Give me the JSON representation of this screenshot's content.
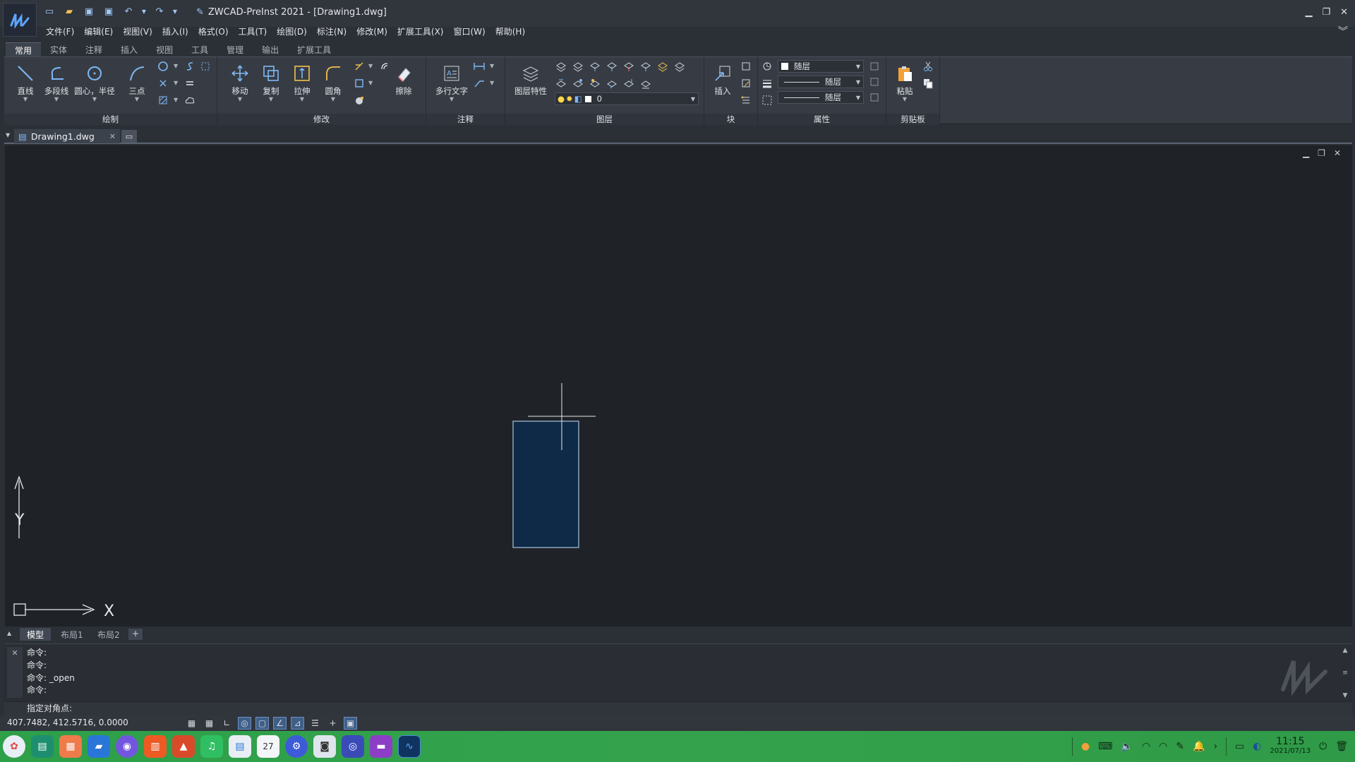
{
  "window": {
    "title": "ZWCAD-PreInst 2021 - [Drawing1.dwg]"
  },
  "menu": [
    "文件(F)",
    "编辑(E)",
    "视图(V)",
    "插入(I)",
    "格式(O)",
    "工具(T)",
    "绘图(D)",
    "标注(N)",
    "修改(M)",
    "扩展工具(X)",
    "窗口(W)",
    "帮助(H)"
  ],
  "ribbon_tabs": [
    "常用",
    "实体",
    "注释",
    "插入",
    "视图",
    "工具",
    "管理",
    "输出",
    "扩展工具"
  ],
  "ribbon": {
    "draw": {
      "title": "绘制",
      "line": "直线",
      "polyline": "多段线",
      "circle": "圆心，半径",
      "arc": "三点"
    },
    "modify": {
      "title": "修改",
      "move": "移动",
      "copy": "复制",
      "stretch": "拉伸",
      "fillet": "圆角",
      "erase": "擦除"
    },
    "annotate": {
      "title": "注释",
      "mtext": "多行文字"
    },
    "layers": {
      "title": "图层",
      "layer_props": "图层特性",
      "current_layer": "0"
    },
    "block": {
      "title": "块",
      "insert": "插入"
    },
    "properties": {
      "title": "属性",
      "color": "随层",
      "linetype": "随层",
      "lineweight": "随层"
    },
    "clipboard": {
      "title": "剪贴板",
      "paste": "粘贴"
    }
  },
  "document_tab": {
    "name": "Drawing1.dwg"
  },
  "ucs": {
    "x_label": "X",
    "y_label": "Y"
  },
  "layout_tabs": [
    "模型",
    "布局1",
    "布局2"
  ],
  "command_history": [
    "命令:",
    "命令:",
    "命令: _open",
    "命令:"
  ],
  "command_prompt": "指定对角点:",
  "status": {
    "coordinates": "407.7482, 412.5716, 0.0000"
  },
  "taskbar": {
    "time": "11:15",
    "date": "2021/07/13"
  },
  "colors": {
    "canvas": "#1f2327",
    "selection_fill": "#0e2a47",
    "taskbar": "#34a24c"
  }
}
